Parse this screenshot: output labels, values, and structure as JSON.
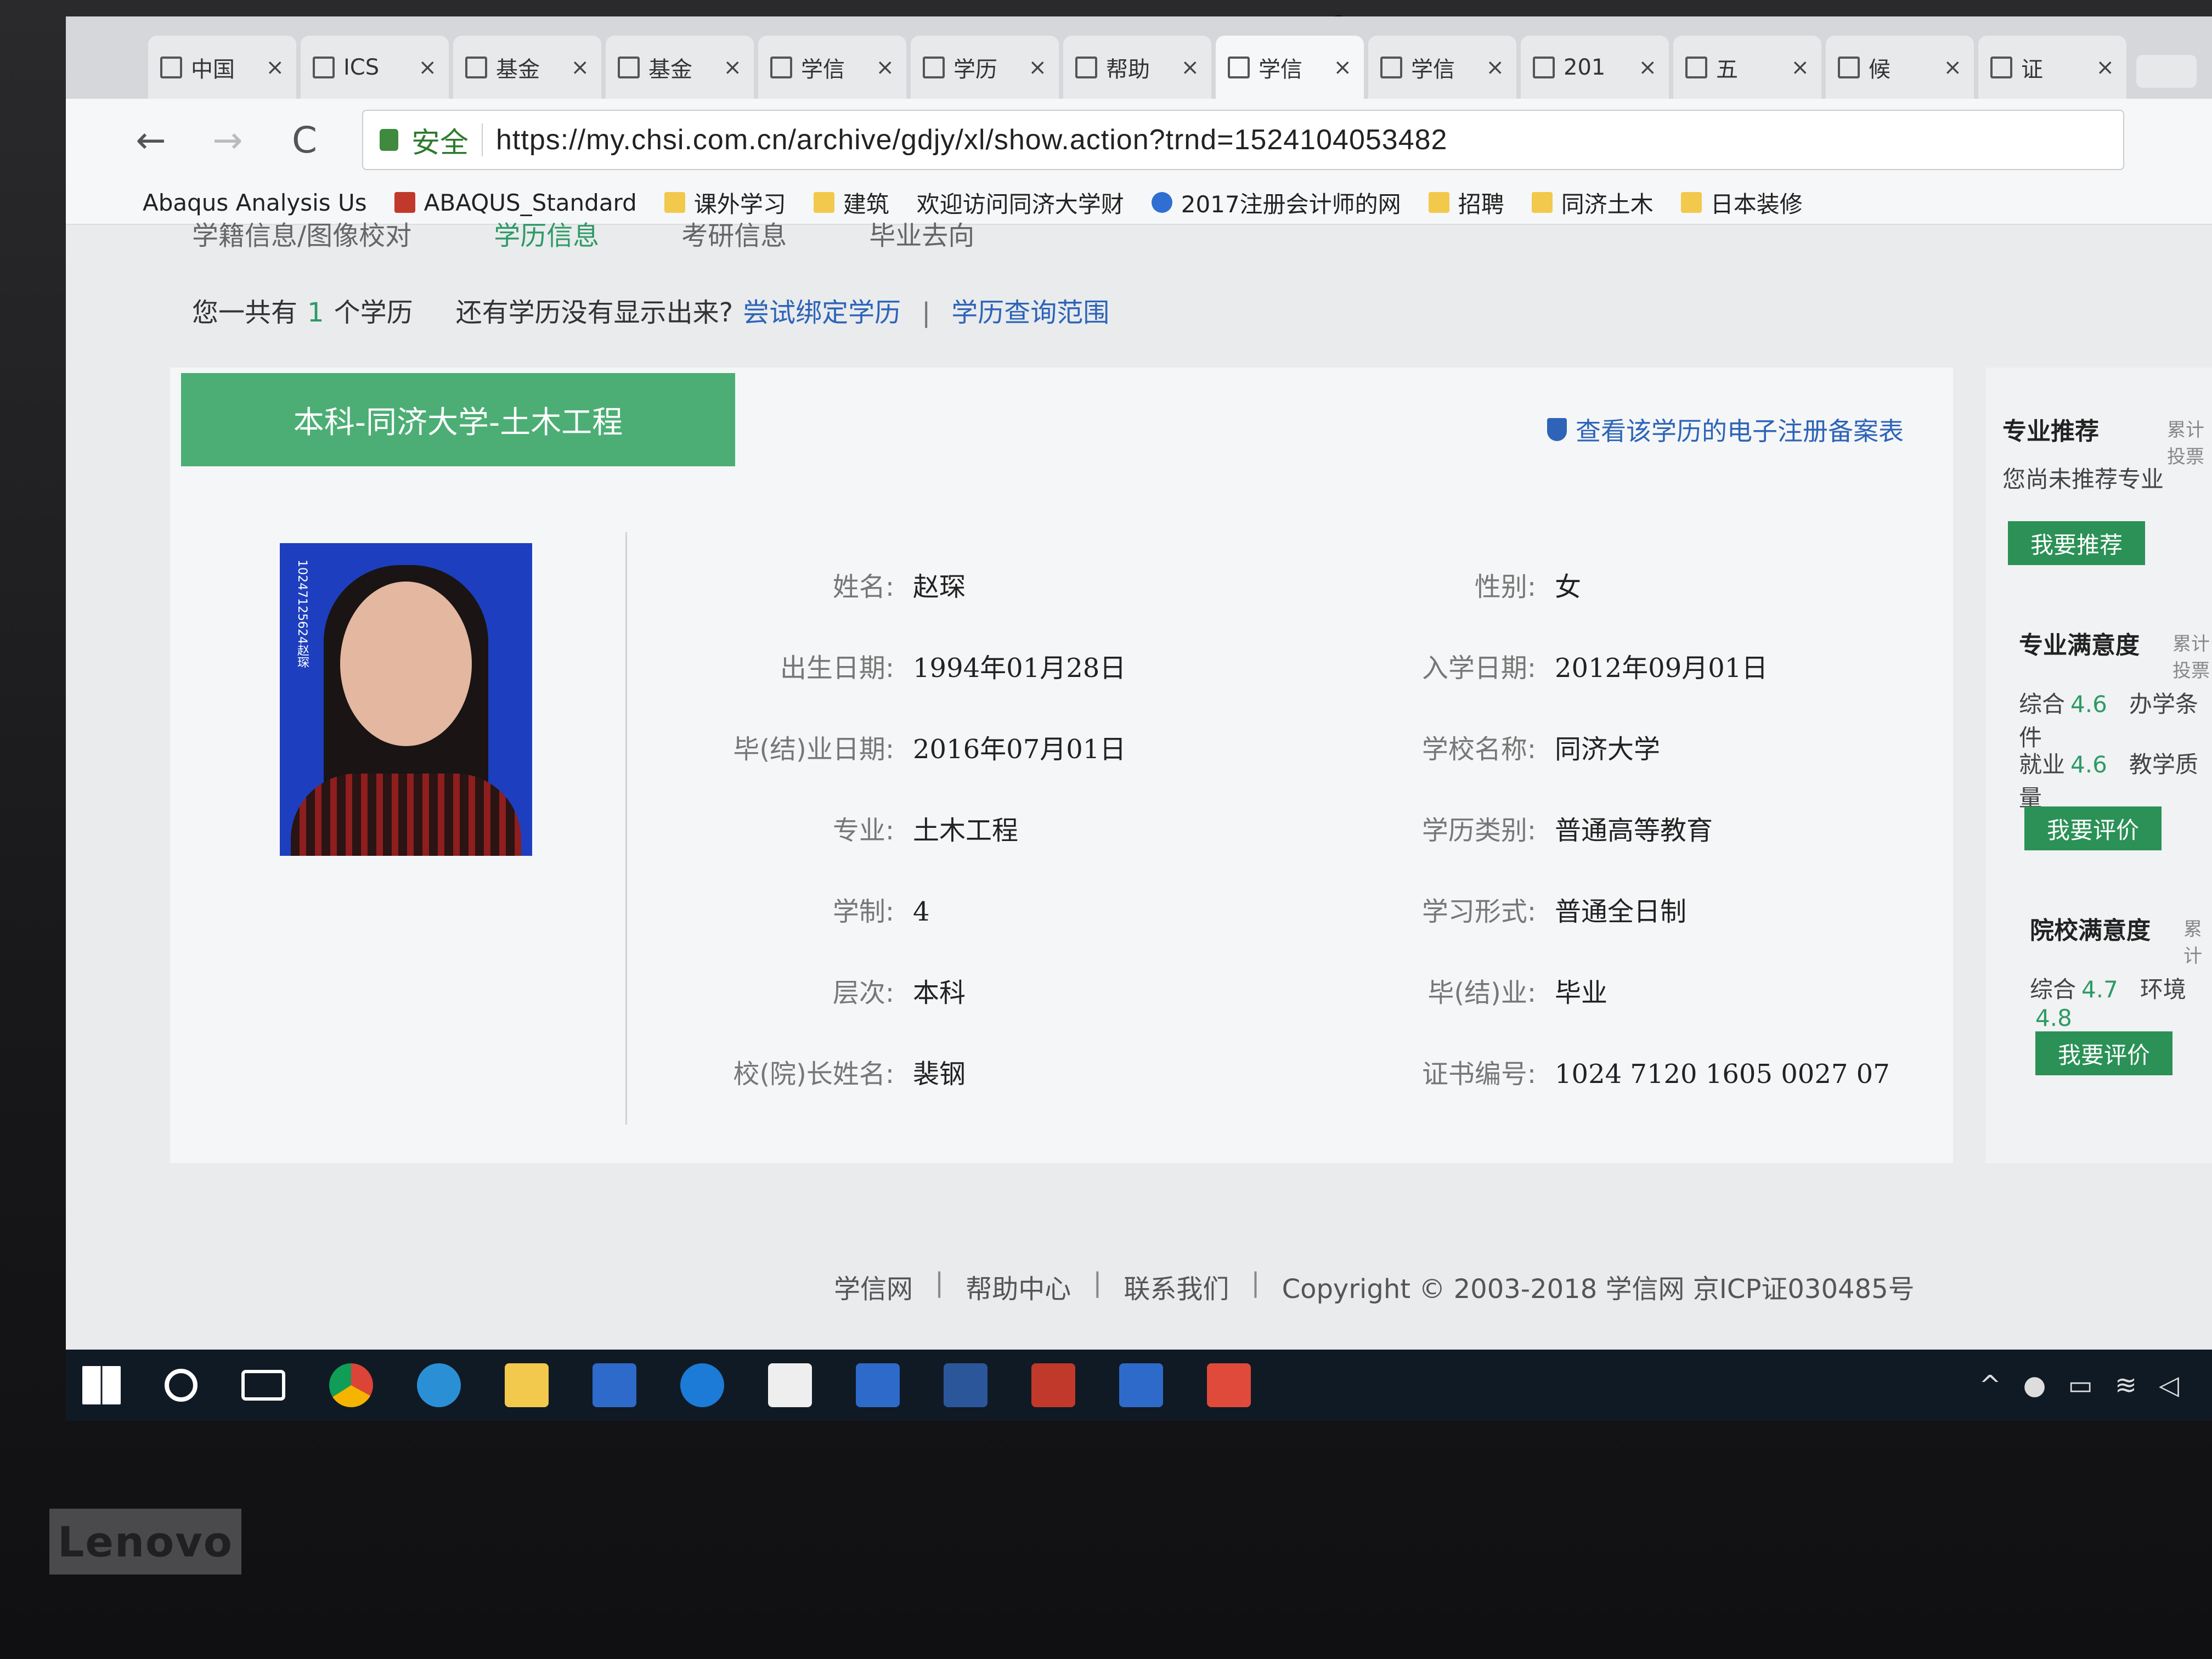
{
  "browser": {
    "tabs": [
      {
        "label": "中国"
      },
      {
        "label": "ICS"
      },
      {
        "label": "基金"
      },
      {
        "label": "基金"
      },
      {
        "label": "学信"
      },
      {
        "label": "学历"
      },
      {
        "label": "帮助"
      },
      {
        "label": "学信"
      },
      {
        "label": "学信"
      },
      {
        "label": "201"
      },
      {
        "label": "五"
      },
      {
        "label": "候"
      },
      {
        "label": "证"
      }
    ],
    "close_glyph": "×",
    "nav": {
      "back": "←",
      "forward": "→",
      "reload": "C"
    },
    "secure_label": "安全",
    "url": "https://my.chsi.com.cn/archive/gdjy/xl/show.action?trnd=1524104053482",
    "bookmarks": [
      {
        "label": "Abaqus Analysis Us",
        "icon": "page"
      },
      {
        "label": "ABAQUS_Standard",
        "icon": "red"
      },
      {
        "label": "课外学习",
        "icon": "folder"
      },
      {
        "label": "建筑",
        "icon": "folder"
      },
      {
        "label": "欢迎访问同济大学财",
        "icon": "page"
      },
      {
        "label": "2017注册会计师的网",
        "icon": "paw"
      },
      {
        "label": "招聘",
        "icon": "folder"
      },
      {
        "label": "同济土木",
        "icon": "folder"
      },
      {
        "label": "日本装修",
        "icon": "folder"
      }
    ]
  },
  "subnav": {
    "items": [
      "学籍信息/图像校对",
      "学历信息",
      "考研信息",
      "毕业去向"
    ],
    "active_index": 1
  },
  "summary": {
    "prefix": "您一共有",
    "count": "1",
    "suffix": "个学历",
    "question": "还有学历没有显示出来?",
    "link_bind": "尝试绑定学历",
    "separator": "|",
    "link_scope": "学历查询范围"
  },
  "record": {
    "title": "本科-同济大学-土木工程",
    "verify_link": "查看该学历的电子注册备案表",
    "photo_id_text": "10247125624赵琛",
    "fields_left": [
      {
        "label": "姓名:",
        "value": "赵琛"
      },
      {
        "label": "出生日期:",
        "value": "1994年01月28日"
      },
      {
        "label": "毕(结)业日期:",
        "value": "2016年07月01日"
      },
      {
        "label": "专业:",
        "value": "土木工程"
      },
      {
        "label": "学制:",
        "value": "4"
      },
      {
        "label": "层次:",
        "value": "本科"
      },
      {
        "label": "校(院)长姓名:",
        "value": "裴钢"
      }
    ],
    "fields_right": [
      {
        "label": "性别:",
        "value": "女"
      },
      {
        "label": "入学日期:",
        "value": "2012年09月01日"
      },
      {
        "label": "学校名称:",
        "value": "同济大学"
      },
      {
        "label": "学历类别:",
        "value": "普通高等教育"
      },
      {
        "label": "学习形式:",
        "value": "普通全日制"
      },
      {
        "label": "毕(结)业:",
        "value": "毕业"
      },
      {
        "label": "证书编号:",
        "value": "1024 7120 1605 0027 07"
      }
    ]
  },
  "sidebar": {
    "major_rec": {
      "title": "专业推荐",
      "meta": "累计投票",
      "text": "您尚未推荐专业",
      "button": "我要推荐"
    },
    "major_sat": {
      "title": "专业满意度",
      "meta": "累计投票",
      "line1": [
        "综合",
        "4.6",
        "办学条件"
      ],
      "line2": [
        "就业",
        "4.6",
        "教学质量"
      ],
      "button": "我要评价"
    },
    "school_sat": {
      "title": "院校满意度",
      "meta": "累计",
      "line1": [
        "综合",
        "4.7",
        "环境",
        "4.8"
      ],
      "button": "我要评价"
    }
  },
  "footer": {
    "links": [
      "学信网",
      "帮助中心",
      "联系我们"
    ],
    "separator": "|",
    "copyright": "Copyright © 2003-2018 学信网 京ICP证030485号"
  },
  "hardware": {
    "brand": "Lenovo"
  },
  "colors": {
    "accent_green": "#4cae75",
    "link_blue": "#2d64b8",
    "button_green": "#2b9156"
  }
}
